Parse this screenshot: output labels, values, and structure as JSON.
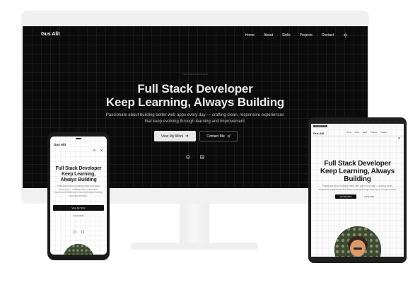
{
  "colors": {
    "desktop_bg": "#0b0b0b",
    "light_bg": "#fafafa",
    "accent_button": "#111111"
  },
  "site": {
    "logo": "Gus Alit",
    "eyebrow": "Full Stack Developer",
    "headline_line1": "Full Stack Developer",
    "headline_line2": "Keep Learning, Always Building",
    "subtitle_line1": "Passionate about building better web apps every day — crafting clean, responsive experiences",
    "subtitle_line2": "that keep evolving through learning and improvement.",
    "primary_cta": "View My Work",
    "secondary_cta": "Contact Me",
    "primary_cta_icon": "arrow-right-icon",
    "secondary_cta_icon": "send-icon",
    "social_icons": [
      "github-icon",
      "linkedin-icon"
    ],
    "nav": [
      "Home",
      "About",
      "Skills",
      "Projects",
      "Contact"
    ],
    "theme_toggle_icon": "sun-icon"
  },
  "phone": {
    "logo": "Gus Alit",
    "headline_line1": "Full Stack Developer",
    "headline_line2": "Keep Learning,",
    "headline_line3": "Always Building",
    "subtitle": "Passionate about building better web apps every day — crafting clean, responsive experiences that keep evolving through learning and improvement.",
    "primary_cta": "View My Work",
    "secondary_cta": "Contact Me"
  },
  "tablet": {
    "status": "Gus Alit • 9:41",
    "logo": "Gus Alit",
    "nav": [
      "Home",
      "About",
      "Skills",
      "Projects",
      "Contact"
    ],
    "headline_line1": "Full Stack Developer",
    "headline_line2": "Keep Learning, Always",
    "headline_line3": "Building",
    "subtitle_line1": "Passionate about building better web apps every day — crafting clean,",
    "subtitle_line2": "responsive experiences that keep evolving through learning and improvement.",
    "primary_cta": "View My Work",
    "secondary_cta": "Contact Me"
  }
}
